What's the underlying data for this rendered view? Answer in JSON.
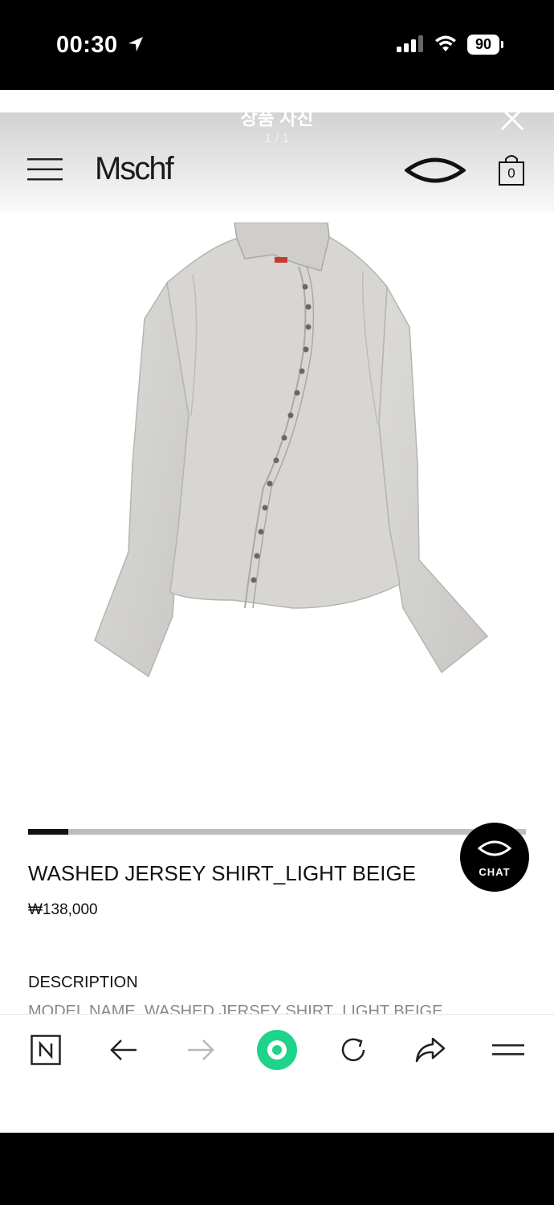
{
  "status_bar": {
    "time": "00:30",
    "battery": "90"
  },
  "viewer": {
    "title": "상품 사진",
    "counter": "1 / 1"
  },
  "header": {
    "brand": "Mschf",
    "cart_count": "0"
  },
  "gallery": {
    "progress": 0.08
  },
  "chat": {
    "label": "CHAT"
  },
  "product": {
    "name": "WASHED JERSEY SHIRT_LIGHT BEIGE",
    "price": "₩138,000",
    "description_heading": "DESCRIPTION",
    "description_line": "MODEL NAME_WASHED JERSEY SHIRT_LIGHT BEIGE"
  },
  "toolbar": {
    "items": [
      "naver-home-icon",
      "back-arrow-icon",
      "forward-arrow-icon",
      "green-dot-icon",
      "reload-icon",
      "share-icon",
      "menu-lines-icon"
    ]
  },
  "colors": {
    "accent_green": "#1ed38a",
    "text": "#111111"
  }
}
